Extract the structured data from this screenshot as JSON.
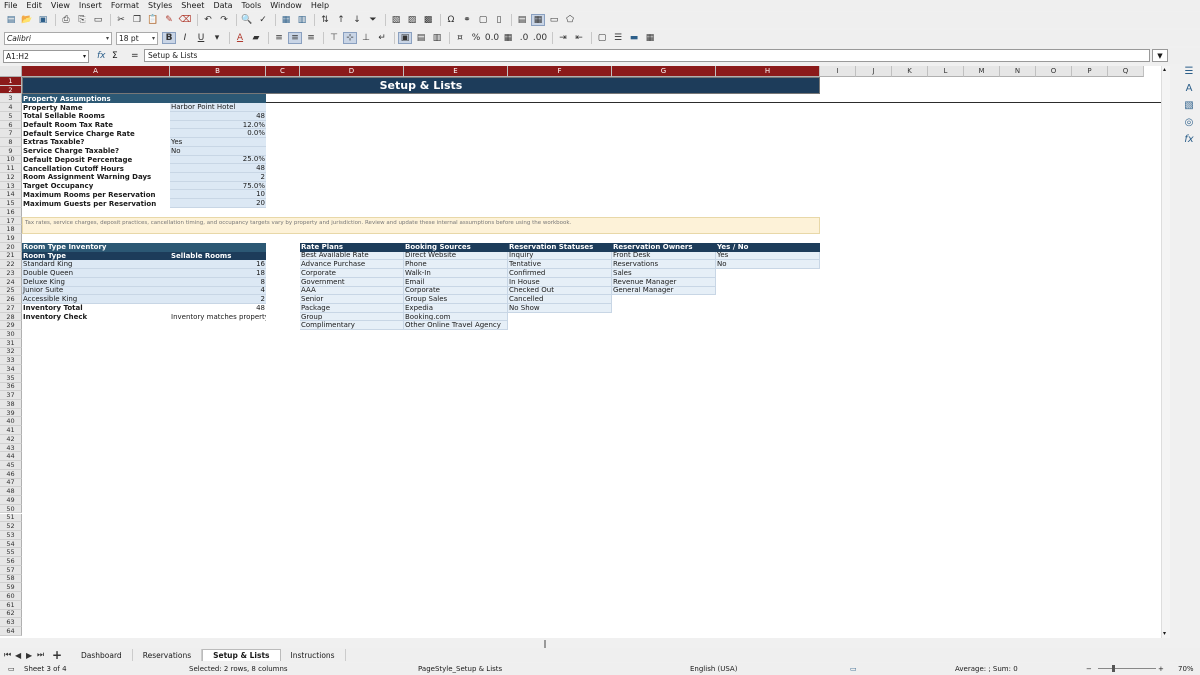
{
  "menu": [
    "File",
    "Edit",
    "View",
    "Insert",
    "Format",
    "Styles",
    "Sheet",
    "Data",
    "Tools",
    "Window",
    "Help"
  ],
  "toolbar": {
    "font_name": "Calibri",
    "font_size": "18 pt"
  },
  "formula": {
    "name_box": "A1:H2",
    "content": "Setup & Lists"
  },
  "columns": [
    "A",
    "B",
    "C",
    "D",
    "E",
    "F",
    "G",
    "H",
    "I",
    "J",
    "K",
    "L",
    "M",
    "N",
    "O",
    "P",
    "Q"
  ],
  "sheet": {
    "title": "Setup & Lists",
    "property_header": "Property Assumptions",
    "property_rows": [
      {
        "label": "Property Name",
        "value": "Harbor Point Hotel",
        "align": "l"
      },
      {
        "label": "Total Sellable Rooms",
        "value": "48",
        "align": "r"
      },
      {
        "label": "Default Room Tax Rate",
        "value": "12.0%",
        "align": "r"
      },
      {
        "label": "Default Service Charge Rate",
        "value": "0.0%",
        "align": "r"
      },
      {
        "label": "Extras Taxable?",
        "value": "Yes",
        "align": "l"
      },
      {
        "label": "Service Charge Taxable?",
        "value": "No",
        "align": "l"
      },
      {
        "label": "Default Deposit Percentage",
        "value": "25.0%",
        "align": "r"
      },
      {
        "label": "Cancellation Cutoff Hours",
        "value": "48",
        "align": "r"
      },
      {
        "label": "Room Assignment Warning Days",
        "value": "2",
        "align": "r"
      },
      {
        "label": "Target Occupancy",
        "value": "75.0%",
        "align": "r"
      },
      {
        "label": "Maximum Rooms per Reservation",
        "value": "10",
        "align": "r"
      },
      {
        "label": "Maximum Guests per Reservation",
        "value": "20",
        "align": "r"
      }
    ],
    "note": "Tax rates, service charges, deposit practices, cancellation timing, and occupancy targets vary by property and jurisdiction. Review and update these internal assumptions before using the workbook.",
    "inventory_header": "Room Type Inventory",
    "inventory_cols": [
      "Room Type",
      "Sellable Rooms"
    ],
    "inventory_rows": [
      {
        "type": "Standard King",
        "rooms": "16"
      },
      {
        "type": "Double Queen",
        "rooms": "18"
      },
      {
        "type": "Deluxe King",
        "rooms": "8"
      },
      {
        "type": "Junior Suite",
        "rooms": "4"
      },
      {
        "type": "Accessible King",
        "rooms": "2"
      }
    ],
    "inventory_total_label": "Inventory Total",
    "inventory_total": "48",
    "inventory_check_label": "Inventory Check",
    "inventory_check": "Inventory matches property total",
    "lists": [
      {
        "header": "Rate Plans",
        "items": [
          "Best Available Rate",
          "Advance Purchase",
          "Corporate",
          "Government",
          "AAA",
          "Senior",
          "Package",
          "Group",
          "Complimentary"
        ]
      },
      {
        "header": "Booking Sources",
        "items": [
          "Direct Website",
          "Phone",
          "Walk-In",
          "Email",
          "Corporate",
          "Group Sales",
          "Expedia",
          "Booking.com",
          "Other Online Travel Agency"
        ]
      },
      {
        "header": "Reservation Statuses",
        "items": [
          "Inquiry",
          "Tentative",
          "Confirmed",
          "In House",
          "Checked Out",
          "Cancelled",
          "No Show"
        ]
      },
      {
        "header": "Reservation Owners",
        "items": [
          "Front Desk",
          "Reservations",
          "Sales",
          "Revenue Manager",
          "General Manager"
        ]
      },
      {
        "header": "Yes / No",
        "items": [
          "Yes",
          "No"
        ]
      }
    ]
  },
  "tabs": [
    "Dashboard",
    "Reservations",
    "Setup & Lists",
    "Instructions"
  ],
  "active_tab": 2,
  "status": {
    "sheet": "Sheet 3 of 4",
    "selection": "Selected: 2 rows, 8 columns",
    "page_style": "PageStyle_Setup & Lists",
    "language": "English (USA)",
    "sum": "Average: ; Sum: 0",
    "zoom": "70%"
  }
}
